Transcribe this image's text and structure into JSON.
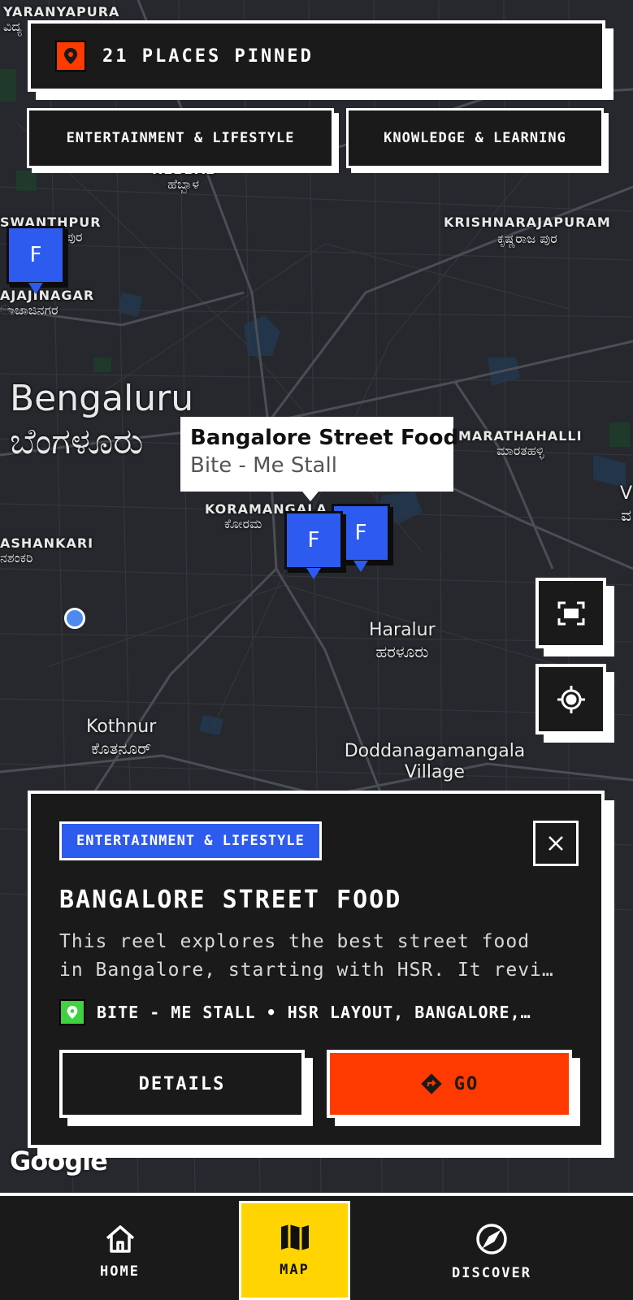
{
  "header": {
    "pinned_label": "21 PLACES PINNED",
    "pin_icon": "map-pin-icon"
  },
  "filters": [
    {
      "label": "ENTERTAINMENT & LIFESTYLE"
    },
    {
      "label": "KNOWLEDGE & LEARNING"
    }
  ],
  "map": {
    "places": {
      "yaranyapura": "YARANYAPURA",
      "yaranyapura_kn": "ವಿದ್ಯ",
      "hebbal": "HEBBAL",
      "hebbal_kn": "ಹೆಬ್ಬಾಳ",
      "yeshwanthpur": "SWANTHPUR",
      "yeshwanthpur_kn": "ಪುರ",
      "rajajinagar": "AJAJINAGAR",
      "rajajinagar_kn": "ಾಜಾಜಿನಗರ",
      "krishnarajapuram": "KRISHNARAJAPURAM",
      "krishnarajapuram_kn": "ಕೃಷ್ಣರಾಜ ಪುರ",
      "bengaluru": "Bengaluru",
      "bengaluru_kn": "ಬೆಂಗಳೂರು",
      "marathahalli": "MARATHAHALLI",
      "marathahalli_kn": "ಮಾರತಹಳ್ಳಿ",
      "koramangala": "KORAMANGALA",
      "koramangala_kn": "ಕೋರಮ",
      "banashankari": "ASHANKARI",
      "banashankari_kn": "ನಶಂಕರಿ",
      "haralur": "Haralur",
      "haralur_kn": "ಹರಳೂರು",
      "kothnur": "Kothnur",
      "kothnur_kn": "ಕೊತನೂರ್",
      "doddanagamangala": "Doddanagamangala Village",
      "edge_v": "V",
      "edge_kn": "ವ"
    },
    "marker_letter": "F",
    "callout": {
      "title": "Bangalore Street Food",
      "subtitle": "Bite - Me Stall"
    },
    "attribution": "Google",
    "fit_icon": "fit-screen-icon",
    "locate_icon": "my-location-icon"
  },
  "card": {
    "tag": "ENTERTAINMENT & LIFESTYLE",
    "title": "BANGALORE STREET FOOD",
    "desc_line1": "This reel explores the best street food",
    "desc_line2": "in Bangalore, starting with HSR. It revi…",
    "location": "BITE - ME STALL • HSR LAYOUT, BANGALORE,…",
    "details_label": "DETAILS",
    "go_label": "GO",
    "colors": {
      "tag": "#2d5bf0",
      "go": "#ff3a00",
      "location_icon": "#3fd13f"
    }
  },
  "nav": {
    "home": "HOME",
    "map": "MAP",
    "discover": "DISCOVER",
    "active": "MAP",
    "active_color": "#ffd400"
  }
}
